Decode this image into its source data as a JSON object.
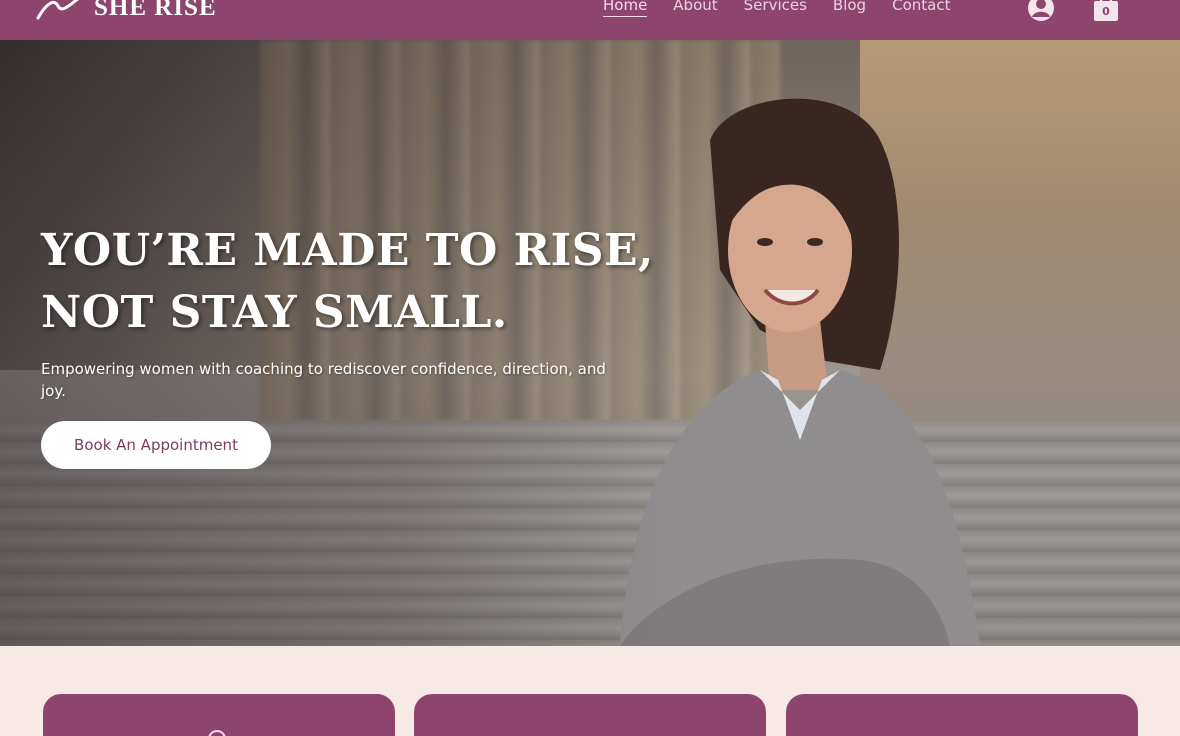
{
  "header": {
    "brand": "SHE RISE",
    "nav": [
      {
        "label": "Home",
        "active": true
      },
      {
        "label": "About",
        "active": false
      },
      {
        "label": "Services",
        "active": false
      },
      {
        "label": "Blog",
        "active": false
      },
      {
        "label": "Contact",
        "active": false
      }
    ],
    "account_icon": "user-account-icon",
    "cart_icon": "shopping-bag-icon",
    "cart_count": "0"
  },
  "hero": {
    "title_line1": "YOU’RE MADE TO RISE,",
    "title_line2": "NOT STAY SMALL.",
    "subtitle": "Empowering women with coaching to rediscover confidence, direction, and joy.",
    "cta_label": "Book An Appointment"
  },
  "colors": {
    "brand": "#8e456d",
    "page_bg": "#f7e9e6",
    "cta_text": "#7f3b62"
  }
}
